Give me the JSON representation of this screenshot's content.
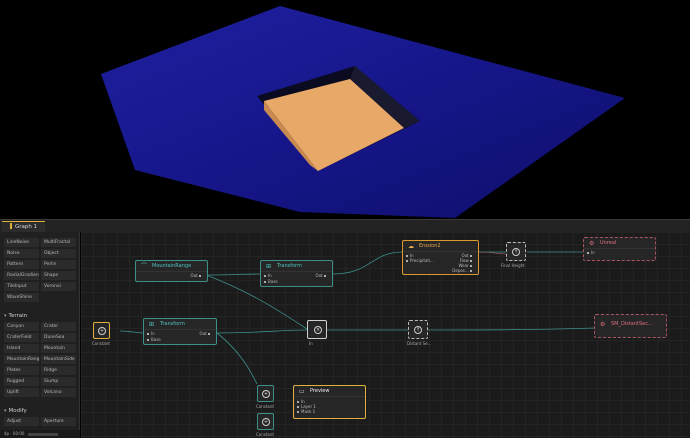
{
  "tab": {
    "label": "Graph 1"
  },
  "sidebar": {
    "group1": [
      "LineNoise",
      "MultiFractal",
      "Noise",
      "Object",
      "Pattern",
      "Perlin",
      "RadialGradient",
      "Shape",
      "TileInput",
      "Voronoi",
      "WaveShine"
    ],
    "terrain_header": "Terrain",
    "terrain": [
      "Canyon",
      "Crater",
      "CraterField",
      "DuneSea",
      "Island",
      "Mountain",
      "MountainRange",
      "MountainSide",
      "Plates",
      "Ridge",
      "Rugged",
      "Slump",
      "Uplift",
      "Volcano"
    ],
    "modify_header": "Modify",
    "modify": [
      "Adjust",
      "Aperture"
    ]
  },
  "status": {
    "text": "4p · 00:00"
  },
  "nodes": {
    "mountain_range": {
      "title": "MountainRange",
      "out": "Out"
    },
    "transform_top": {
      "title": "Transform",
      "in": "In",
      "base": "Base",
      "out": "Out"
    },
    "transform_left": {
      "title": "Transform",
      "in": "In",
      "base": "Base",
      "out": "Out"
    },
    "erosion": {
      "title": "Erosion2",
      "in": "In",
      "precip": "Precipitati...",
      "out": "Out",
      "flow": "Flow",
      "wear": "Wear",
      "deposits": "Depos..."
    },
    "unreal": {
      "title": "Unreal",
      "in": "In"
    },
    "sm_distant": {
      "title": "SM_DistantSec..."
    },
    "preview": {
      "title": "Preview",
      "in": "In",
      "layer1": "Layer 1",
      "mask1": "Mask 1"
    }
  },
  "labels": {
    "constant_left": "Constant",
    "final_height": "Final Height",
    "combine": "In",
    "distant_se": "Distant Se...",
    "constant_a": "Constant",
    "constant_b": "Constant"
  },
  "colors": {
    "terrain": "#1a1a8c",
    "sand": "#e8a868",
    "teal": "#3d8f8a",
    "accent": "#e0b03a",
    "export": "#aa5560"
  }
}
